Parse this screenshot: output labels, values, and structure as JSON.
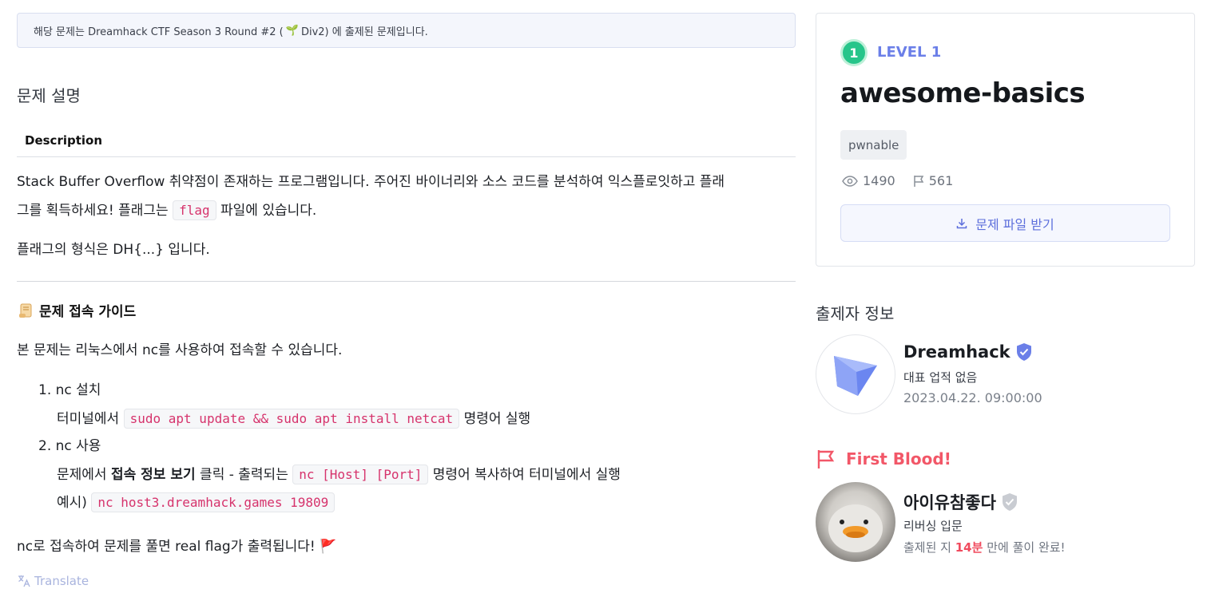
{
  "notice": {
    "before": "해당 문제는 Dreamhack CTF Season 3 Round #2 (",
    "emoji": "🌱",
    "after": "Div2) 에 출제된 문제입니다."
  },
  "section_title": "문제 설명",
  "description_tab": "Description",
  "description": {
    "line1": "Stack Buffer Overflow 취약점이 존재하는 프로그램입니다. 주어진 바이너리와 소스 코드를 분석하여 익스플로잇하고 플래",
    "line2_before": "그를 획득하세요! 플래그는 ",
    "line2_code": "flag",
    "line2_after": " 파일에 있습니다.",
    "line3": "플래그의 형식은 DH{...} 입니다."
  },
  "guide": {
    "title": "문제 접속 가이드",
    "intro": "본 문제는 리눅스에서 nc를 사용하여 접속할 수 있습니다.",
    "step1_title": "1. nc 설치",
    "step1_before": "터미널에서 ",
    "step1_code": "sudo apt update && sudo apt install netcat",
    "step1_after": " 명령어 실행",
    "step2_title": "2. nc 사용",
    "step2_before": "문제에서 ",
    "step2_bold": "접속 정보 보기",
    "step2_mid": " 클릭 - 출력되는 ",
    "step2_code": "nc [Host] [Port]",
    "step2_after": " 명령어 복사하여 터미널에서 실행",
    "example_label": "예시) ",
    "example_code": "nc host3.dreamhack.games 19809",
    "outro": "nc로 접속하여 문제를 풀면 real flag가 출력됩니다! ",
    "outro_emoji": "🚩"
  },
  "translate_label": "Translate",
  "challenge": {
    "level_number": "1",
    "level_label": "LEVEL 1",
    "title": "awesome-basics",
    "tag": "pwnable",
    "views": "1490",
    "solves": "561",
    "download_label": "문제 파일 받기"
  },
  "author": {
    "section_title": "출제자 정보",
    "name": "Dreamhack",
    "achievement": "대표 업적 없음",
    "date": "2023.04.22. 09:00:00"
  },
  "first_blood": {
    "title": "First Blood!",
    "name": "아이유참좋다",
    "achievement": "리버싱 입문",
    "time_before": "출제된 지 ",
    "time_value": "14분",
    "time_after": " 만에 풀이 완료!"
  },
  "colors": {
    "accent": "#6b7fe8",
    "level_green": "#27c58a",
    "first_blood_red": "#f25768",
    "code_pink": "#d6336c"
  }
}
